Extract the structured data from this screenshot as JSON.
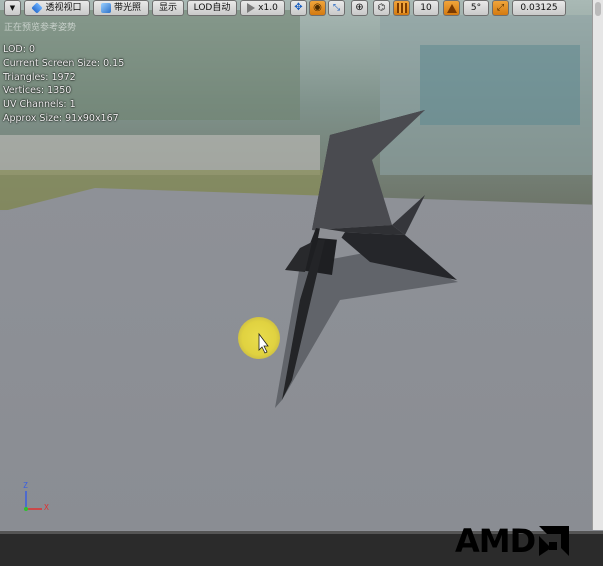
{
  "toolbar": {
    "perspective_label": "透视视口",
    "lit_label": "带光照",
    "show_label": "显示",
    "lod_label": "LOD自动",
    "speed_label": "x1.0",
    "grid_snap_value": "10",
    "rotation_snap_value": "5°",
    "scale_snap_value": "0.03125"
  },
  "viewport": {
    "subtitle": "正在预览参考姿势"
  },
  "stats": {
    "lod": "LOD: 0",
    "screen_size": "Current Screen Size: 0.15",
    "triangles": "Triangles: 1972",
    "vertices": "Vertices: 1350",
    "uv_channels": "UV Channels: 1",
    "approx_size": "Approx Size: 91x90x167"
  },
  "axis": {
    "z": "Z",
    "x": "X"
  },
  "watermark": {
    "brand": "AMD"
  },
  "colors": {
    "floor": "#8d9096",
    "toolbar_orange": "#e08a1e",
    "cursor_highlight": "#e4d846"
  }
}
